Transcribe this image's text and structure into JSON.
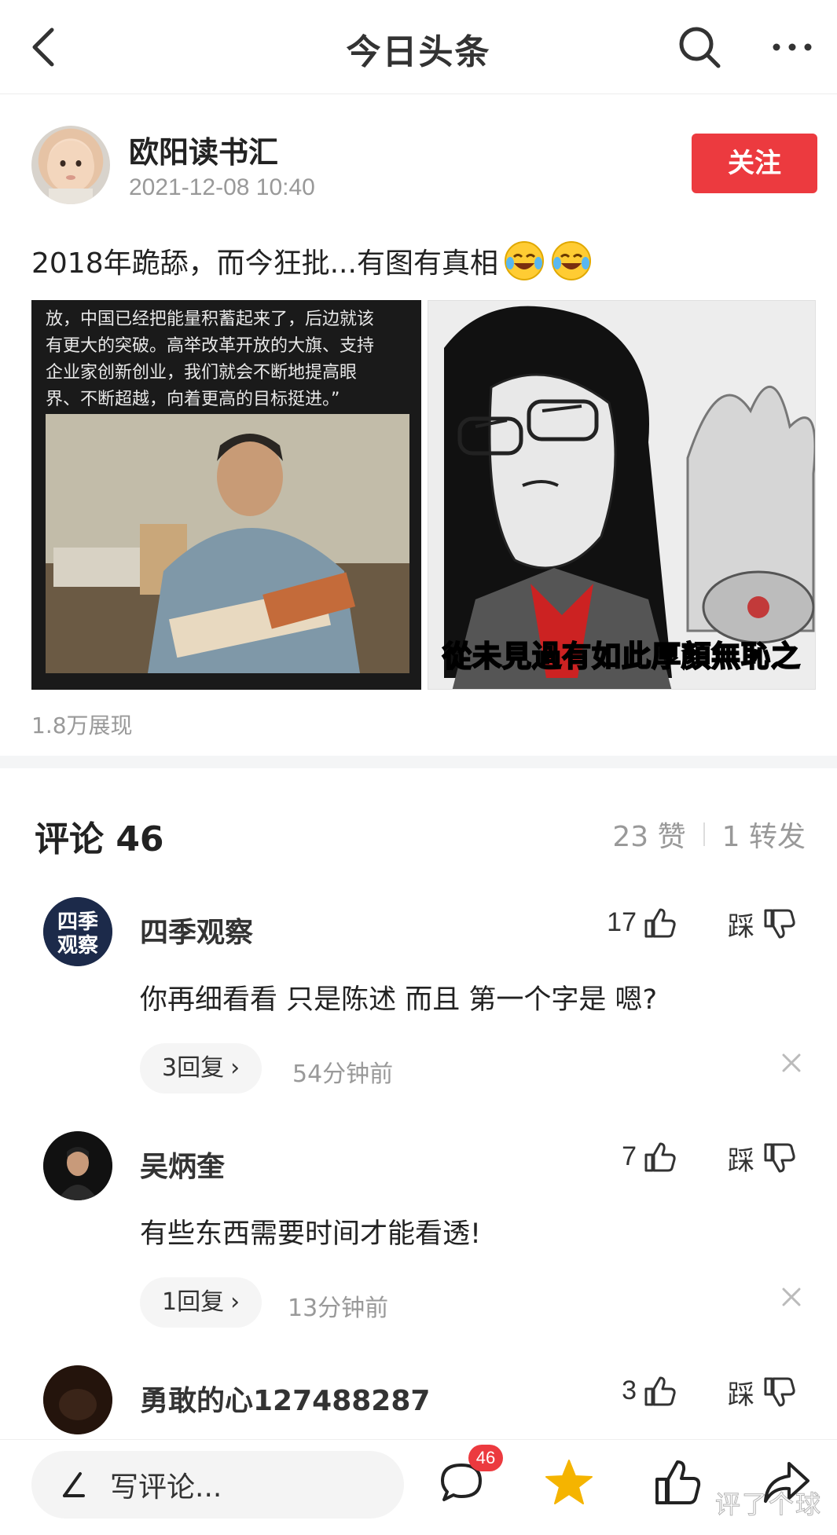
{
  "header": {
    "title": "今日头条",
    "icons": [
      "back-icon",
      "search-icon",
      "more-icon"
    ]
  },
  "post": {
    "author": "欧阳读书汇",
    "time": "2021-12-08 10:40",
    "follow_label": "关注",
    "text": "2018年跪舔，而今狂批...有图有真相",
    "emoji": "crying-laughing-emoji",
    "image_left_quote": "放，中国已经把能量积蓄起来了，后边就该\n有更大的突破。高举改革开放的大旗、支持\n企业家创新创业，我们就会不断地提高眼\n界、不断超越，向着更高的目标挺进。”",
    "image_right_caption": "從未見過有如此厚顏無恥之",
    "views": "1.8万展现"
  },
  "comments_header": {
    "title": "评论 46",
    "likes": "23 赞",
    "shares": "1 转发"
  },
  "comments": [
    {
      "name": "四季观察",
      "avatar_text": "四季观察",
      "likes": "17",
      "dislike_label": "踩",
      "text": "你再细看看 只是陈述 而且 第一个字是 嗯?",
      "replies": "3回复",
      "time": "54分钟前"
    },
    {
      "name": "吴炳奎",
      "likes": "7",
      "dislike_label": "踩",
      "text": "有些东西需要时间才能看透!",
      "replies": "1回复",
      "time": "13分钟前"
    },
    {
      "name": "勇敢的心127488287",
      "likes": "3",
      "dislike_label": "踩"
    }
  ],
  "bottom_bar": {
    "input_placeholder": "写评论...",
    "comment_count_badge": "46",
    "accent_color": "#ec3a3f",
    "star_color": "#f5b400",
    "watermark": "评了个球"
  }
}
